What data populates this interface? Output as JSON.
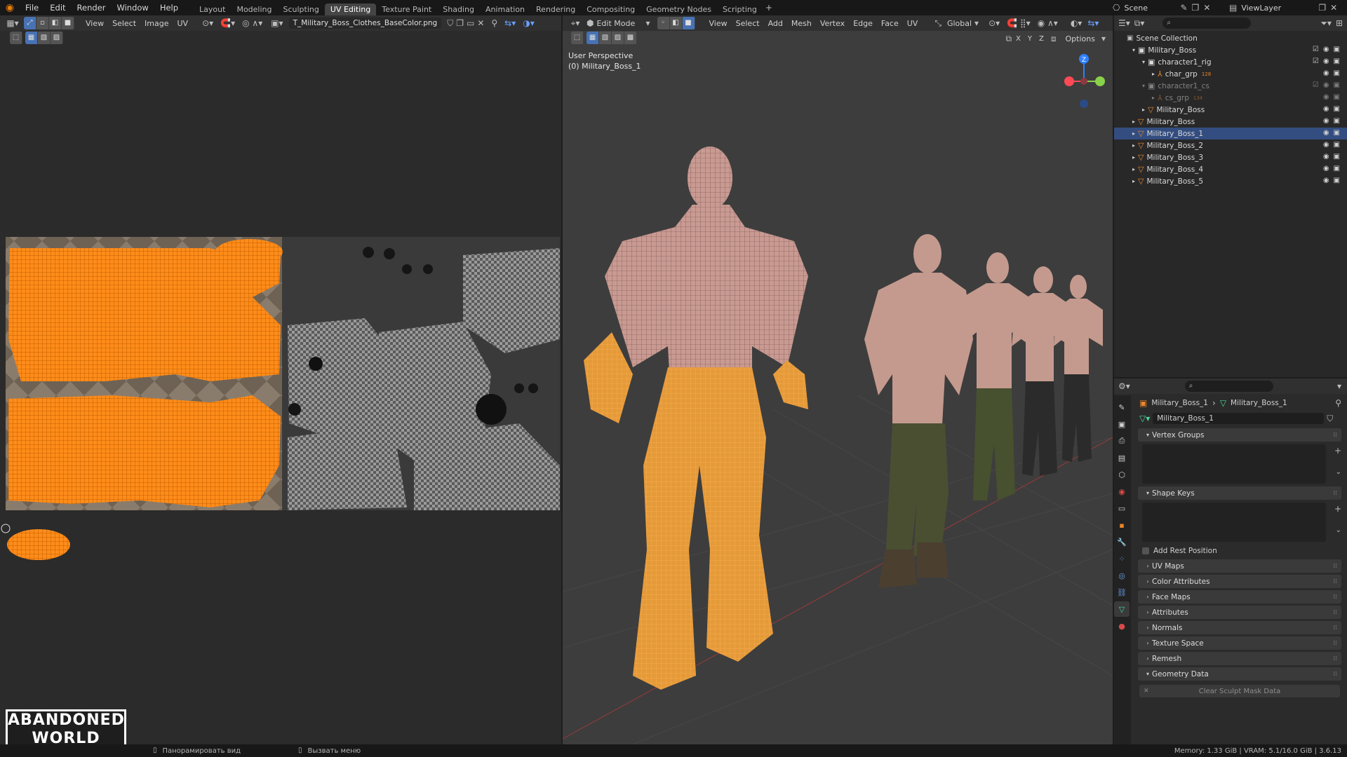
{
  "menubar": {
    "items": [
      "File",
      "Edit",
      "Render",
      "Window",
      "Help"
    ],
    "workspaces": [
      "Layout",
      "Modeling",
      "Sculpting",
      "UV Editing",
      "Texture Paint",
      "Shading",
      "Animation",
      "Rendering",
      "Compositing",
      "Geometry Nodes",
      "Scripting"
    ],
    "active_workspace": "UV Editing",
    "scene": "Scene",
    "view_layer": "ViewLayer"
  },
  "uv_editor": {
    "menus": [
      "View",
      "Select",
      "Image",
      "UV"
    ],
    "image_name": "T_Military_Boss_Clothes_BaseColor.png"
  },
  "viewport": {
    "mode": "Edit Mode",
    "menus": [
      "View",
      "Select",
      "Add",
      "Mesh",
      "Vertex",
      "Edge",
      "Face",
      "UV"
    ],
    "orientation": "Global",
    "axes": [
      "X",
      "Y",
      "Z"
    ],
    "options": "Options",
    "perspective": "User Perspective",
    "object_label": "(0) Military_Boss_1",
    "gizmo_z": "Z"
  },
  "outliner": {
    "root": "Scene Collection",
    "rows": [
      {
        "label": "Military_Boss",
        "depth": 0,
        "type": "collection"
      },
      {
        "label": "character1_rig",
        "depth": 1,
        "type": "collection"
      },
      {
        "label": "char_grp",
        "depth": 2,
        "type": "armature",
        "badge": "128"
      },
      {
        "label": "character1_cs",
        "depth": 1,
        "type": "collection",
        "dim": true
      },
      {
        "label": "cs_grp",
        "depth": 2,
        "type": "armature",
        "badge": "134",
        "dim": true
      },
      {
        "label": "Military_Boss",
        "depth": 1,
        "type": "mesh"
      },
      {
        "label": "Military_Boss",
        "depth": 0,
        "type": "mesh"
      },
      {
        "label": "Military_Boss_1",
        "depth": 0,
        "type": "mesh"
      },
      {
        "label": "Military_Boss_2",
        "depth": 0,
        "type": "mesh"
      },
      {
        "label": "Military_Boss_3",
        "depth": 0,
        "type": "mesh"
      },
      {
        "label": "Military_Boss_4",
        "depth": 0,
        "type": "mesh"
      },
      {
        "label": "Military_Boss_5",
        "depth": 0,
        "type": "mesh"
      }
    ]
  },
  "properties": {
    "breadcrumb_object": "Military_Boss_1",
    "breadcrumb_data": "Military_Boss_1",
    "data_name": "Military_Boss_1",
    "panels": [
      "Vertex Groups",
      "Shape Keys",
      "UV Maps",
      "Color Attributes",
      "Face Maps",
      "Attributes",
      "Normals",
      "Texture Space",
      "Remesh",
      "Geometry Data"
    ],
    "add_rest_position": "Add Rest Position",
    "clear_sculpt": "Clear Sculpt Mask Data"
  },
  "statusbar": {
    "pan": "Панорамировать вид",
    "menu": "Вызвать меню",
    "stats": "Memory: 1.33 GiB | VRAM: 5.1/16.0 GiB | 3.6.13"
  },
  "watermark": {
    "line1": "ABANDONED",
    "line2": "WORLD"
  },
  "colors": {
    "accent": "#4772b3",
    "selection": "#ff8c1a",
    "header": "#303030",
    "viewport": "#3d3d3d"
  }
}
